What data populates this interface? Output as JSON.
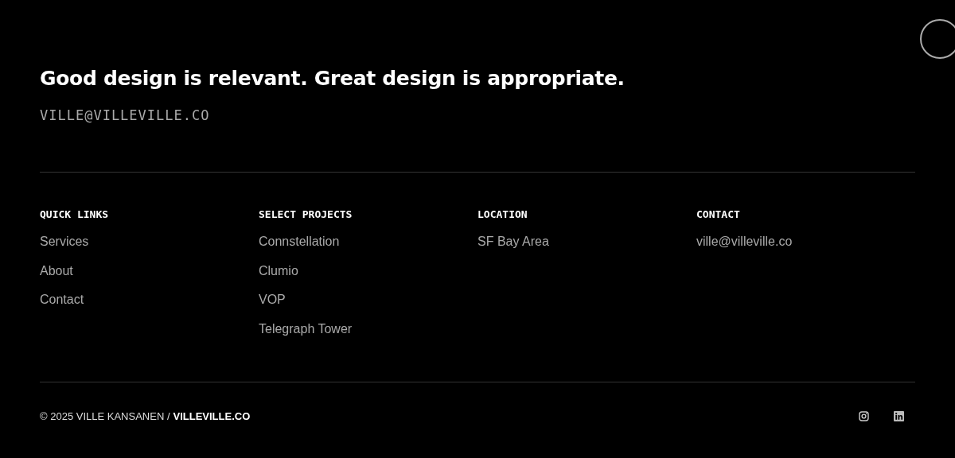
{
  "headline": "Good design is relevant. Great design is appropriate.",
  "email": "VILLE@VILLEVILLE.CO",
  "columns": [
    {
      "heading": "QUICK LINKS",
      "links": [
        "Services",
        "About",
        "Contact"
      ]
    },
    {
      "heading": "SELECT PROJECTS",
      "links": [
        "Connstellation",
        "Clumio",
        "VOP",
        "Telegraph Tower"
      ]
    },
    {
      "heading": "LOCATION",
      "links": [
        "SF Bay Area"
      ]
    },
    {
      "heading": "CONTACT",
      "links": [
        "ville@villeville.co"
      ]
    }
  ],
  "footer": {
    "copyright": "© 2025 VILLE KANSANEN /",
    "site_link": "VILLEVILLE.CO",
    "social": [
      {
        "kind": "instagram"
      },
      {
        "kind": "linkedin"
      }
    ]
  }
}
